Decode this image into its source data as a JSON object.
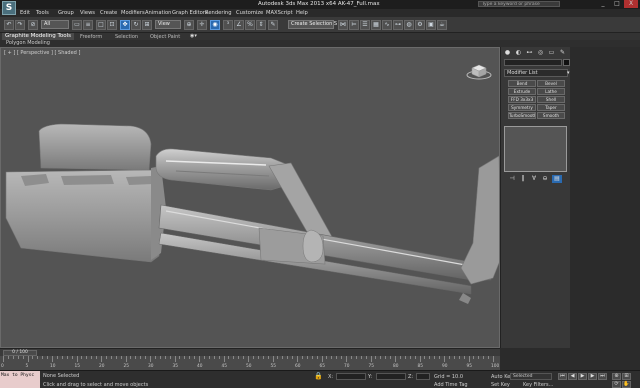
{
  "window": {
    "title": "Autodesk 3ds Max 2013 x64    AK-47_Full.max",
    "search_placeholder": "Type a keyword or phrase",
    "logo_letter": "S",
    "controls": [
      "_",
      "□",
      "X"
    ]
  },
  "menu": [
    "Edit",
    "Tools",
    "Group",
    "Views",
    "Create",
    "Modifiers",
    "Animation",
    "Graph Editors",
    "Rendering",
    "Customize",
    "MAXScript",
    "Help"
  ],
  "toolbar": {
    "filter_value": "All",
    "coord_value": "View",
    "selection_set": "Create Selection S"
  },
  "ribbon": {
    "tabs": [
      "Graphite Modeling Tools",
      "Freeform",
      "Selection",
      "Object Paint"
    ],
    "sub_label": "Polygon Modeling"
  },
  "viewport": {
    "label": "[ + ] [ Perspective ] [ Shaded ]"
  },
  "command_panel": {
    "tab_icons": [
      "create-icon",
      "modify-icon",
      "hierarchy-icon",
      "motion-icon",
      "display-icon",
      "utilities-icon"
    ],
    "modifier_list": "Modifier List",
    "modifier_buttons": [
      "Bend",
      "Bevel",
      "Extrude",
      "Lathe",
      "FFD 3x3x3",
      "Shell",
      "Symmetry",
      "Taper",
      "TurboSmooth",
      "Smooth"
    ],
    "stack_icons": [
      "pin-stack-icon",
      "show-end-result-icon",
      "make-unique-icon",
      "remove-modifier-icon",
      "configure-modifier-sets-icon"
    ]
  },
  "timeline": {
    "slider_label": "0 / 100",
    "ticks": [
      "0",
      "5",
      "10",
      "15",
      "20",
      "25",
      "30",
      "35",
      "40",
      "45",
      "50",
      "55",
      "60",
      "65",
      "70",
      "75",
      "80",
      "85",
      "90",
      "95",
      "100"
    ]
  },
  "status": {
    "maxscript": "Max to Physc",
    "selection": "None Selected",
    "prompt": "Click and drag to select and move objects",
    "x_label": "X:",
    "y_label": "Y:",
    "z_label": "Z:",
    "grid": "Grid = 10.0",
    "add_time_tag": "Add Time Tag",
    "auto_key": "Auto Key",
    "set_key": "Set Key",
    "selected": "Selected",
    "key_filters": "Key Filters..."
  }
}
